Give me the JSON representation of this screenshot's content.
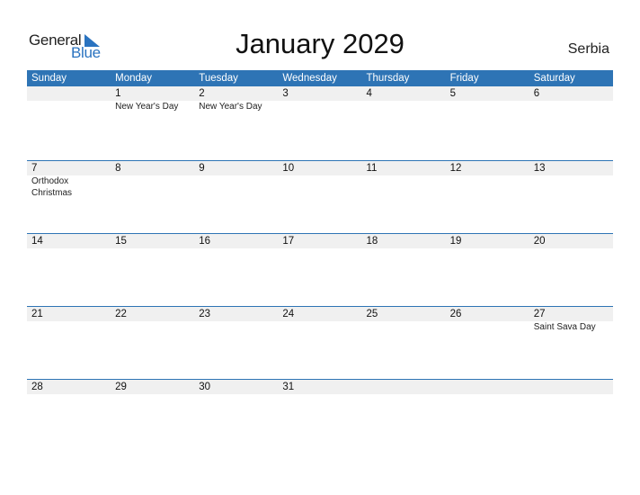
{
  "logo": {
    "line1": "General",
    "line2": "Blue",
    "accent": "#2a73c0"
  },
  "title": "January 2029",
  "country": "Serbia",
  "header_color": "#2e74b5",
  "weekdays": [
    "Sunday",
    "Monday",
    "Tuesday",
    "Wednesday",
    "Thursday",
    "Friday",
    "Saturday"
  ],
  "weeks": [
    [
      {
        "day": "",
        "holiday": ""
      },
      {
        "day": "1",
        "holiday": "New Year's Day"
      },
      {
        "day": "2",
        "holiday": "New Year's Day"
      },
      {
        "day": "3",
        "holiday": ""
      },
      {
        "day": "4",
        "holiday": ""
      },
      {
        "day": "5",
        "holiday": ""
      },
      {
        "day": "6",
        "holiday": ""
      }
    ],
    [
      {
        "day": "7",
        "holiday": "Orthodox Christmas"
      },
      {
        "day": "8",
        "holiday": ""
      },
      {
        "day": "9",
        "holiday": ""
      },
      {
        "day": "10",
        "holiday": ""
      },
      {
        "day": "11",
        "holiday": ""
      },
      {
        "day": "12",
        "holiday": ""
      },
      {
        "day": "13",
        "holiday": ""
      }
    ],
    [
      {
        "day": "14",
        "holiday": ""
      },
      {
        "day": "15",
        "holiday": ""
      },
      {
        "day": "16",
        "holiday": ""
      },
      {
        "day": "17",
        "holiday": ""
      },
      {
        "day": "18",
        "holiday": ""
      },
      {
        "day": "19",
        "holiday": ""
      },
      {
        "day": "20",
        "holiday": ""
      }
    ],
    [
      {
        "day": "21",
        "holiday": ""
      },
      {
        "day": "22",
        "holiday": ""
      },
      {
        "day": "23",
        "holiday": ""
      },
      {
        "day": "24",
        "holiday": ""
      },
      {
        "day": "25",
        "holiday": ""
      },
      {
        "day": "26",
        "holiday": ""
      },
      {
        "day": "27",
        "holiday": "Saint Sava Day"
      }
    ],
    [
      {
        "day": "28",
        "holiday": ""
      },
      {
        "day": "29",
        "holiday": ""
      },
      {
        "day": "30",
        "holiday": ""
      },
      {
        "day": "31",
        "holiday": ""
      },
      {
        "day": "",
        "holiday": ""
      },
      {
        "day": "",
        "holiday": ""
      },
      {
        "day": "",
        "holiday": ""
      }
    ]
  ]
}
